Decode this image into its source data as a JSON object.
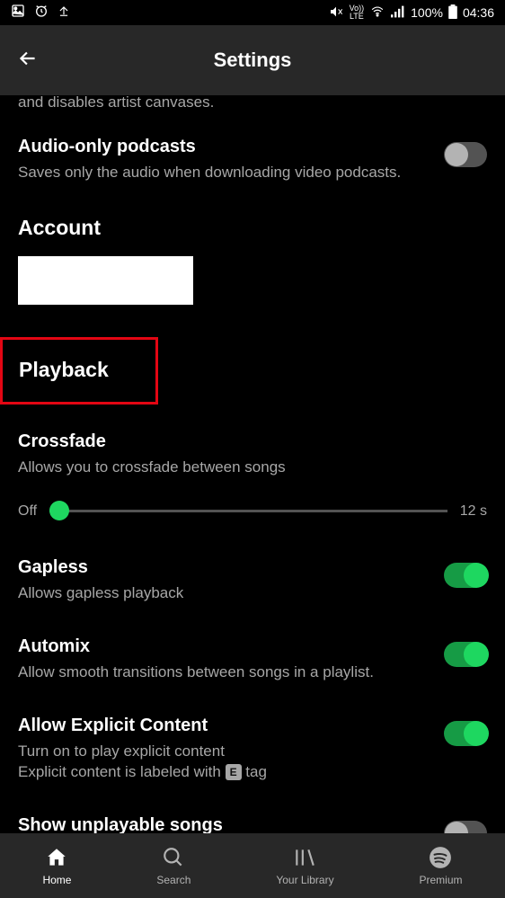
{
  "status": {
    "battery": "100%",
    "time": "04:36",
    "vo_lte": "VoLTE"
  },
  "header": {
    "title": "Settings"
  },
  "truncated": "and disables artist canvases.",
  "audio_only": {
    "title": "Audio-only podcasts",
    "desc": "Saves only the audio when downloading video podcasts."
  },
  "account": {
    "heading": "Account"
  },
  "playback": {
    "heading": "Playback"
  },
  "crossfade": {
    "title": "Crossfade",
    "desc": "Allows you to crossfade between songs",
    "min_label": "Off",
    "max_label": "12 s"
  },
  "gapless": {
    "title": "Gapless",
    "desc": "Allows gapless playback"
  },
  "automix": {
    "title": "Automix",
    "desc": "Allow smooth transitions between songs in a playlist."
  },
  "explicit": {
    "title": "Allow Explicit Content",
    "desc1": "Turn on to play explicit content",
    "desc2a": "Explicit content is labeled with ",
    "desc2b": "E",
    "desc2c": " tag"
  },
  "unplayable": {
    "title": "Show unplayable songs"
  },
  "nav": {
    "home": "Home",
    "search": "Search",
    "library": "Your Library",
    "premium": "Premium"
  }
}
